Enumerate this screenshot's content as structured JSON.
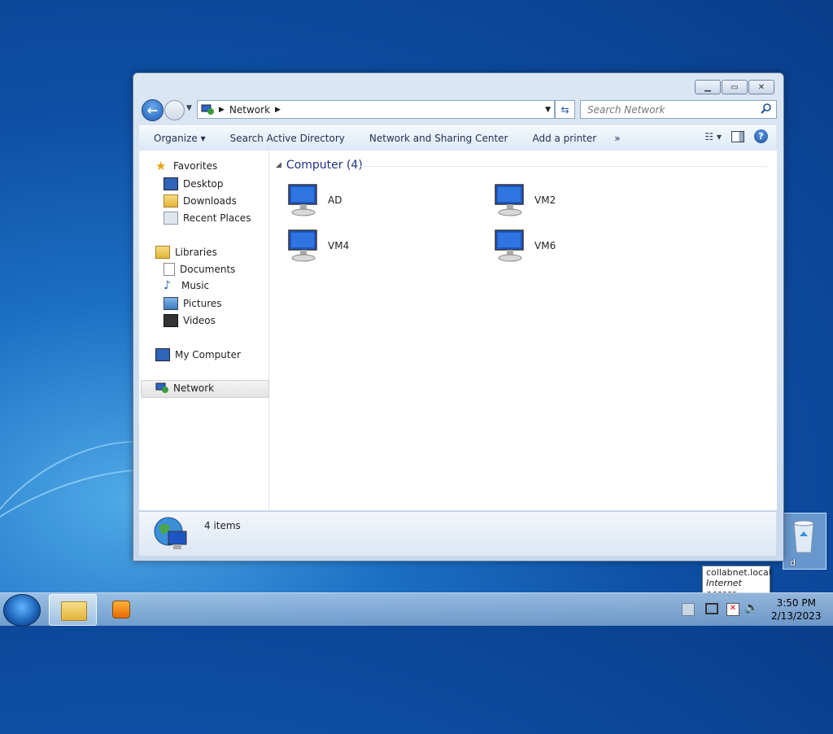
{
  "window": {
    "address_location": "Network",
    "search_placeholder": "Search Network",
    "caption_minimize": "minimize",
    "caption_maximize": "maximize",
    "caption_close": "close"
  },
  "command_bar": {
    "organize": "Organize",
    "search_ad": "Search Active Directory",
    "network_sharing": "Network and Sharing Center",
    "add_printer": "Add a printer",
    "more": "»"
  },
  "nav_pane": {
    "favorites": "Favorites",
    "desktop": "Desktop",
    "downloads": "Downloads",
    "recent_places": "Recent Places",
    "libraries": "Libraries",
    "documents": "Documents",
    "music": "Music",
    "pictures": "Pictures",
    "videos": "Videos",
    "my_computer": "My Computer",
    "network": "Network"
  },
  "content": {
    "group_header": "Computer (4)",
    "computers": [
      "AD",
      "VM2",
      "VM4",
      "VM6"
    ]
  },
  "status": {
    "item_count": "4 items"
  },
  "desktop": {
    "recycle_label": "d"
  },
  "tooltip": {
    "line1": "collabnet.local",
    "line2": "Internet access"
  },
  "clock": {
    "time": "3:50 PM",
    "date": "2/13/2023"
  },
  "colors": {
    "accent": "#1e3287",
    "window_frame": "#c9d9ec",
    "desktop": "#0d4fa4"
  }
}
